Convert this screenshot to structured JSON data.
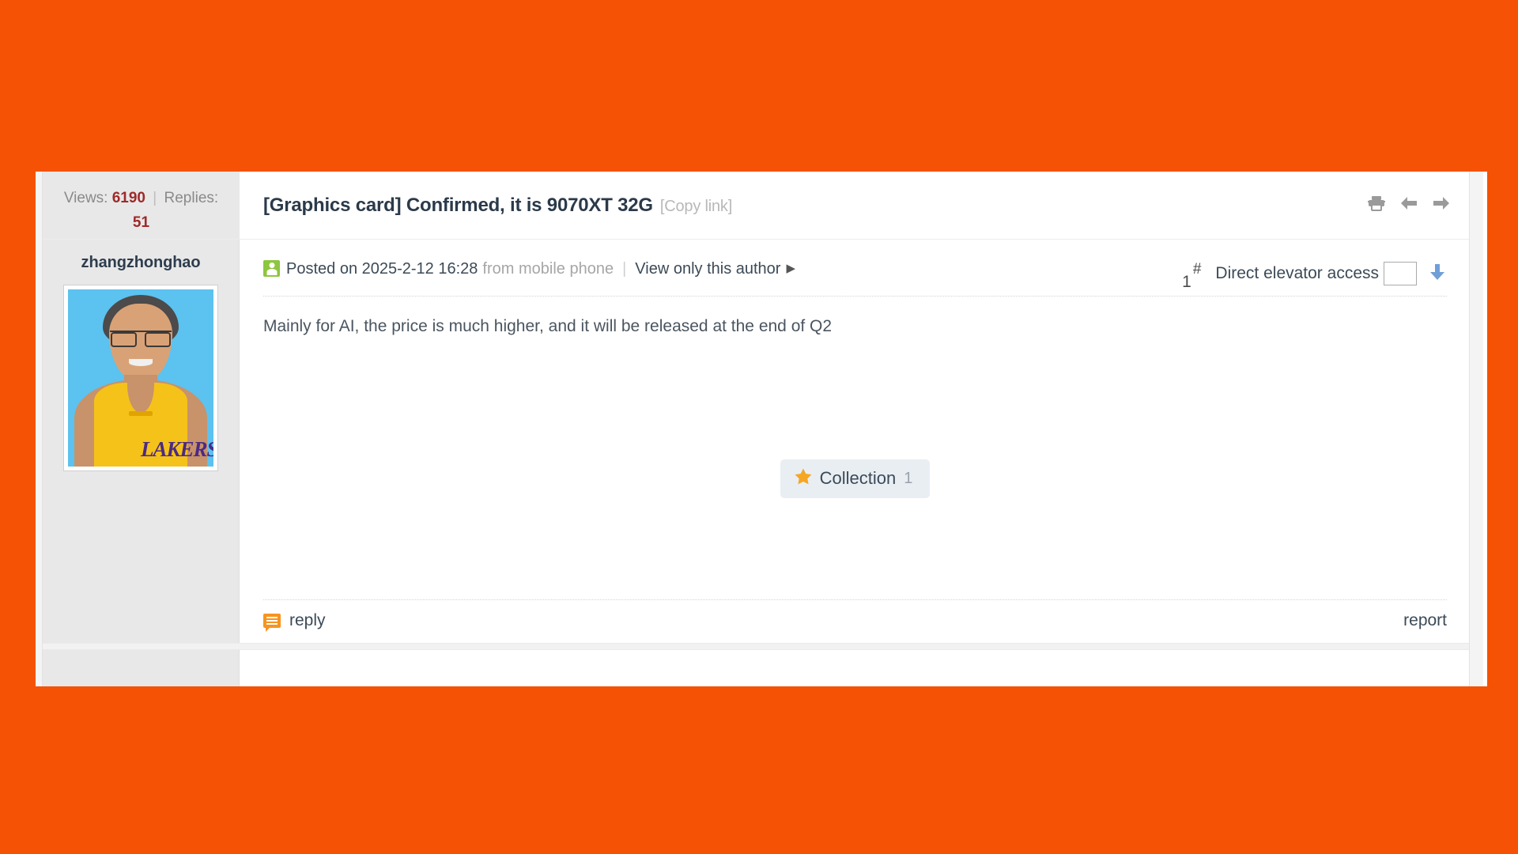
{
  "theme": {
    "page_background": "#f55205",
    "card_background": "#ffffff",
    "sidebar_background": "#e8e8e8",
    "accent_red": "#9e2a2a",
    "accent_orange": "#f7941e",
    "accent_green": "#8dc63f",
    "link_color": "#3c4a57",
    "muted_color": "#a6a6a6"
  },
  "thread_header": {
    "views_label": "Views:",
    "views_count": "6190",
    "separator": "|",
    "replies_label": "Replies:",
    "replies_count": "51",
    "title": "[Graphics card] Confirmed, it is 9070XT 32G",
    "copy_link_label": "[Copy link]",
    "tools": [
      {
        "name": "print-icon",
        "label": "print"
      },
      {
        "name": "previous-thread-icon",
        "label": "previous"
      },
      {
        "name": "next-thread-icon",
        "label": "next"
      }
    ]
  },
  "post": {
    "author": {
      "username": "zhangzhonghao",
      "avatar_alt": "man wearing yellow Lakers basketball jersey",
      "avatar_wordmark": "LAKERS"
    },
    "meta": {
      "mobile_badge_name": "mobile-post-icon",
      "posted_on": "Posted on 2025-2-12 16:28",
      "from_device": "from mobile phone",
      "pipe": "|",
      "view_author_only": "View only this author",
      "view_author_caret": "▶",
      "floor_number": "1",
      "floor_hash": "#",
      "elevator_label": "Direct elevator access",
      "elevator_input_value": "",
      "elevator_input_placeholder": "",
      "jump_arrow_name": "jump-down-icon"
    },
    "body_text": "Mainly for AI, the price is much higher, and it will be released at the end of Q2",
    "collection": {
      "icon_name": "star-icon",
      "label": "Collection",
      "count": "1"
    },
    "footer": {
      "reply_icon_name": "reply-bubble-icon",
      "reply_label": "reply",
      "report_label": "report"
    }
  }
}
